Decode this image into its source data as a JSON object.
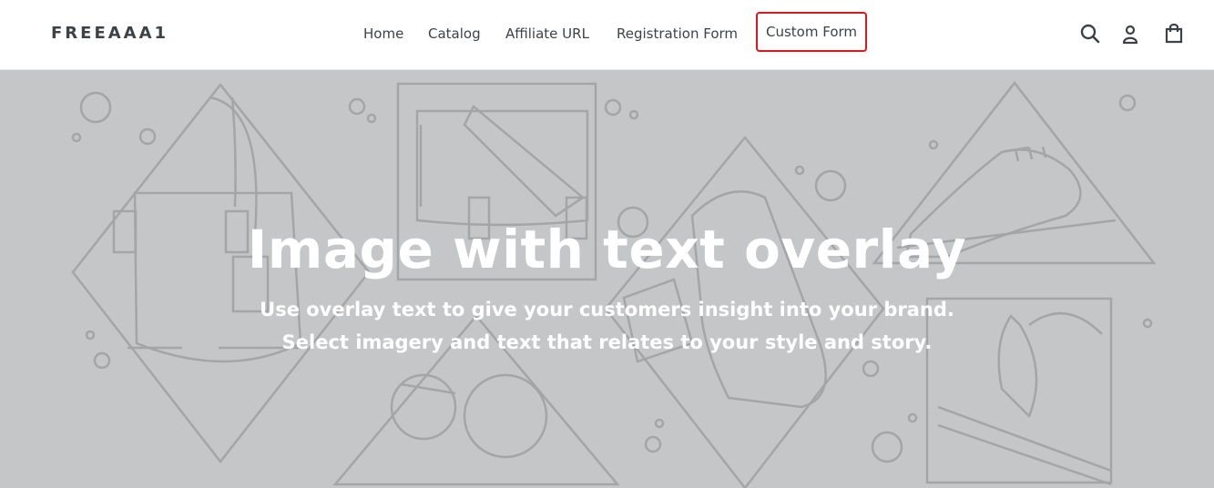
{
  "header": {
    "logo": "FREEAAA1",
    "nav": [
      {
        "label": "Home"
      },
      {
        "label": "Catalog"
      },
      {
        "label": "Affiliate URL"
      },
      {
        "label": "Registration Form"
      },
      {
        "label": "Custom Form"
      }
    ],
    "icons": [
      "search-icon",
      "account-icon",
      "cart-icon"
    ]
  },
  "hero": {
    "title": "Image with text overlay",
    "subtitle_line1": "Use overlay text to give your customers insight into your brand.",
    "subtitle_line2": "Select imagery and text that relates to your style and story."
  },
  "colors": {
    "hero_bg": "#c5c6c8",
    "line_art": "#a4a5a7",
    "highlight": "#e3141b",
    "text": "#3d4246"
  }
}
